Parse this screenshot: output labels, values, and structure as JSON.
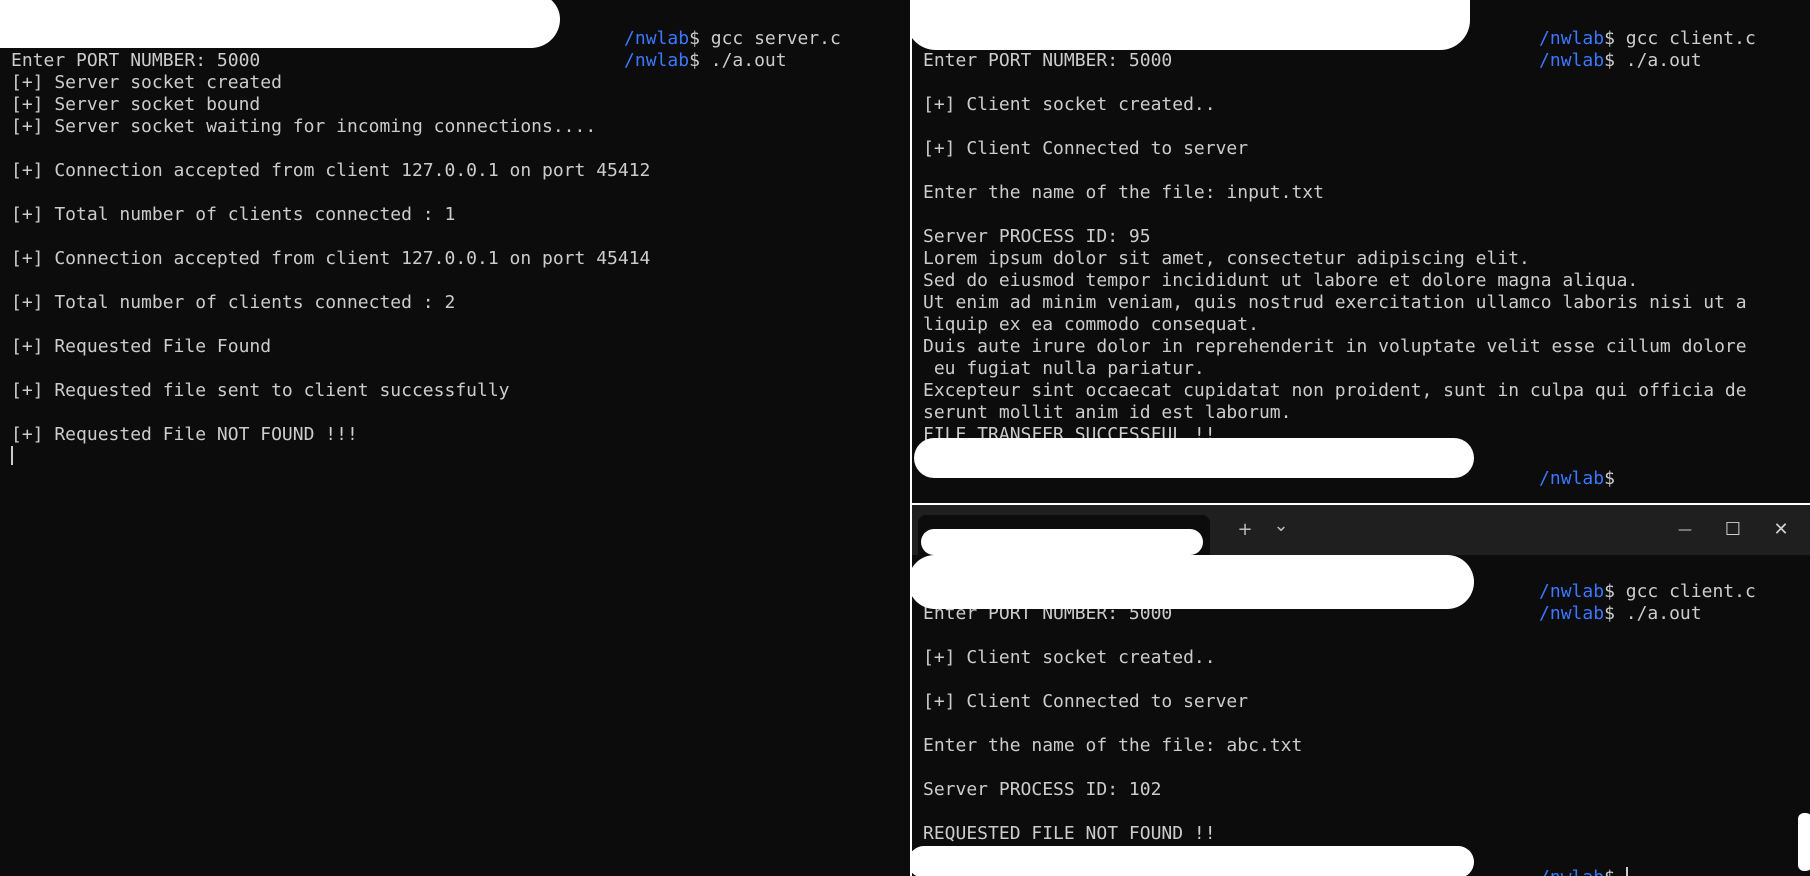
{
  "server": {
    "prompt_path": "/nwlab",
    "prompt_symbol": "$",
    "commands": [
      "gcc server.c",
      "./a.out"
    ],
    "output": [
      "Enter PORT NUMBER: 5000",
      "[+] Server socket created",
      "[+] Server socket bound",
      "[+] Server socket waiting for incoming connections....",
      "",
      "[+] Connection accepted from client 127.0.0.1 on port 45412",
      "",
      "[+] Total number of clients connected : 1",
      "",
      "[+] Connection accepted from client 127.0.0.1 on port 45414",
      "",
      "[+] Total number of clients connected : 2",
      "",
      "[+] Requested File Found",
      "",
      "[+] Requested file sent to client successfully",
      "",
      "[+] Requested File NOT FOUND !!!"
    ]
  },
  "client1": {
    "prompt_path": "/nwlab",
    "prompt_symbol": "$",
    "commands": [
      "gcc client.c",
      "./a.out"
    ],
    "output": [
      "Enter PORT NUMBER: 5000",
      "",
      "[+] Client socket created..",
      "",
      "[+] Client Connected to server",
      "",
      "Enter the name of the file: input.txt",
      "",
      "Server PROCESS ID: 95",
      "Lorem ipsum dolor sit amet, consectetur adipiscing elit.",
      "Sed do eiusmod tempor incididunt ut labore et dolore magna aliqua.",
      "Ut enim ad minim veniam, quis nostrud exercitation ullamco laboris nisi ut a",
      "liquip ex ea commodo consequat.",
      "Duis aute irure dolor in reprehenderit in voluptate velit esse cillum dolore",
      " eu fugiat nulla pariatur.",
      "Excepteur sint occaecat cupidatat non proident, sunt in culpa qui officia de",
      "serunt mollit anim id est laborum.",
      "FILE TRANSFER SUCCESSFUL !!"
    ],
    "final_prompt_path": "/nwlab",
    "final_prompt_symbol": "$"
  },
  "client2_window": {
    "new_tab_label": "+",
    "tab_menu_label": "⌄",
    "minimize_label": "—",
    "maximize_label": "☐",
    "close_label": "✕"
  },
  "client2": {
    "prompt_path": "/nwlab",
    "prompt_symbol": "$",
    "commands": [
      "gcc client.c",
      "./a.out"
    ],
    "output": [
      "Enter PORT NUMBER: 5000",
      "",
      "[+] Client socket created..",
      "",
      "[+] Client Connected to server",
      "",
      "Enter the name of the file: abc.txt",
      "",
      "Server PROCESS ID: 102",
      "",
      "REQUESTED FILE NOT FOUND !!"
    ],
    "final_prompt_path": "/nwlab",
    "final_prompt_symbol": "$"
  },
  "colors": {
    "terminal_bg": "#0c0c0c",
    "terminal_fg": "#cccccc",
    "prompt_path": "#3b78ff",
    "titlebar_bg": "#1f1f1f"
  }
}
